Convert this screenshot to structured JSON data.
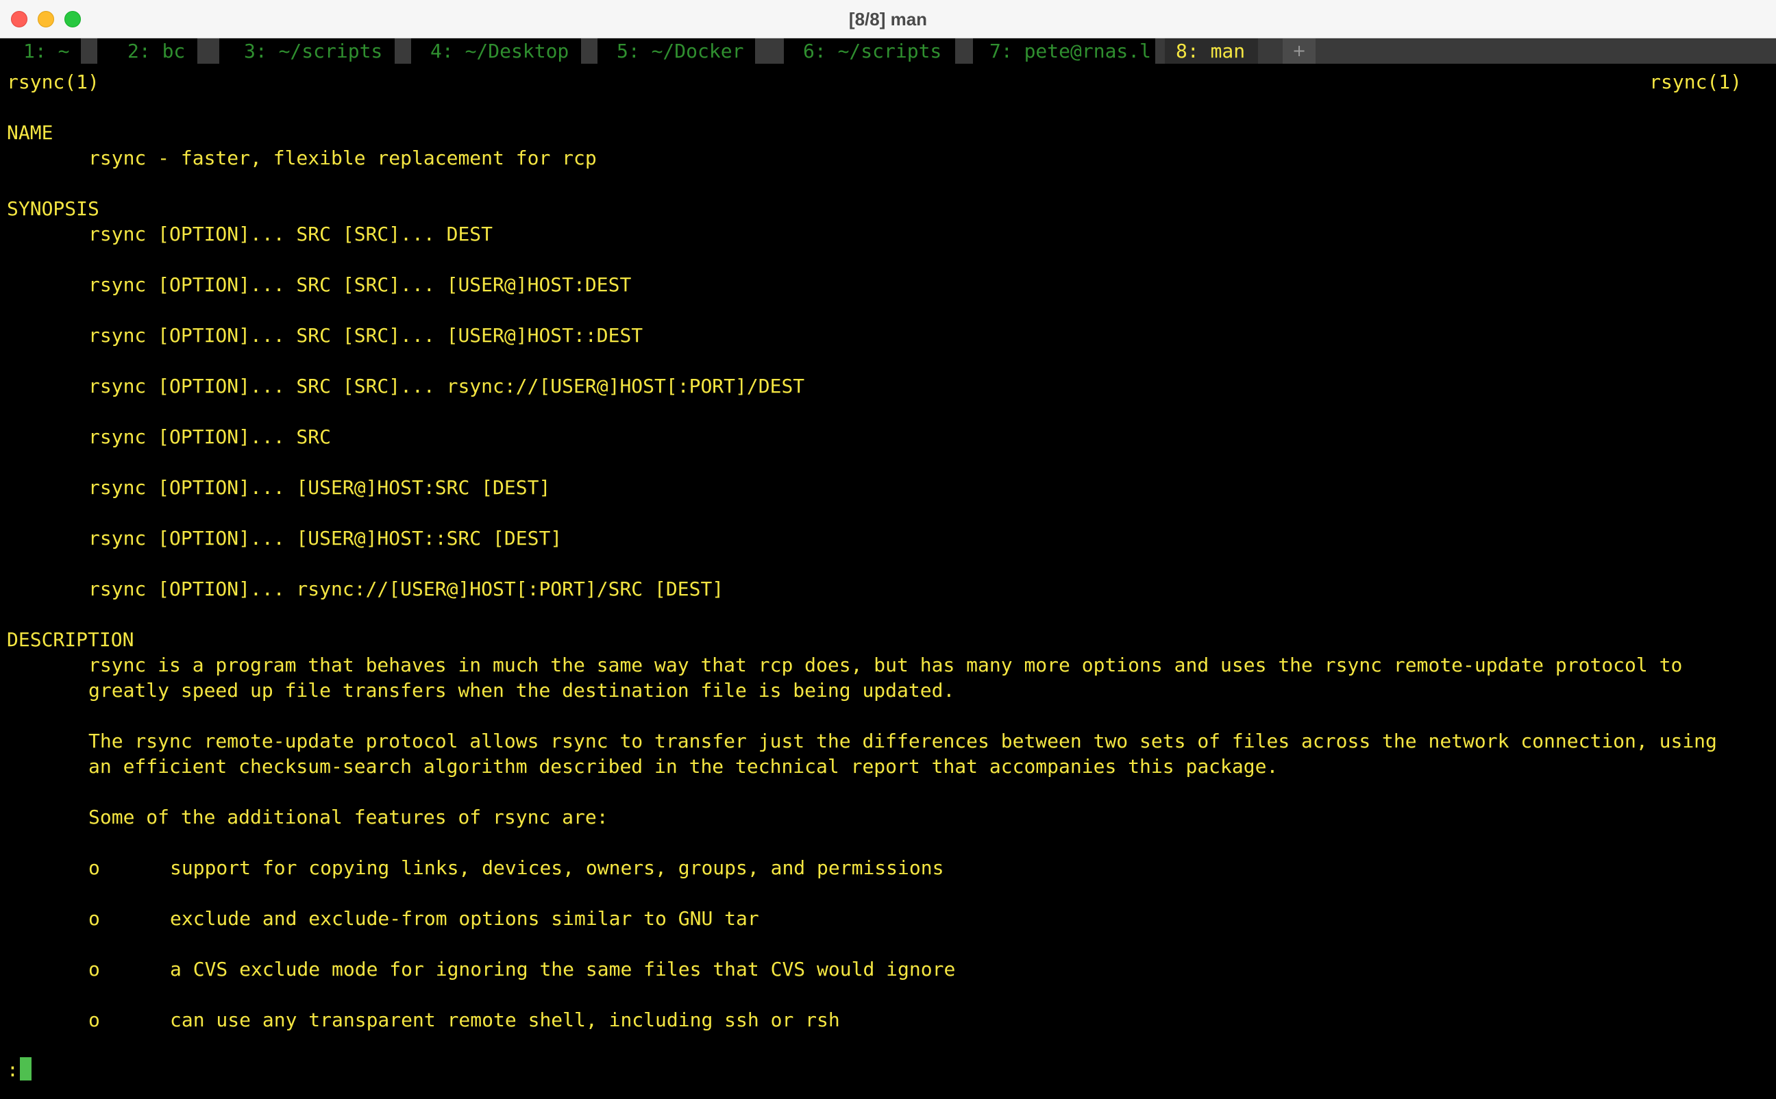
{
  "window": {
    "title": "[8/8] man"
  },
  "colors": {
    "terminal_bg": "#000000",
    "text": "#f5e642",
    "tab_inactive_text": "#2f8f2f",
    "tab_active_text": "#f5e642",
    "cursor": "#4fbf4f"
  },
  "tabs": [
    {
      "label": "1: ~",
      "active": false
    },
    {
      "label": "2: bc",
      "active": false
    },
    {
      "label": "3: ~/scripts",
      "active": false
    },
    {
      "label": "4: ~/Desktop",
      "active": false
    },
    {
      "label": "5: ~/Docker",
      "active": false
    },
    {
      "label": "6: ~/scripts",
      "active": false
    },
    {
      "label": "7: pete@rnas.l",
      "active": false
    },
    {
      "label": "8: man",
      "active": true
    }
  ],
  "tab_add_label": "+",
  "manpage": {
    "header_left": "rsync(1)",
    "header_right": "rsync(1)",
    "name_heading": "NAME",
    "name_text": "rsync - faster, flexible replacement for rcp",
    "synopsis_heading": "SYNOPSIS",
    "synopsis": [
      "rsync [OPTION]... SRC [SRC]... DEST",
      "rsync [OPTION]... SRC [SRC]... [USER@]HOST:DEST",
      "rsync [OPTION]... SRC [SRC]... [USER@]HOST::DEST",
      "rsync [OPTION]... SRC [SRC]... rsync://[USER@]HOST[:PORT]/DEST",
      "rsync [OPTION]... SRC",
      "rsync [OPTION]... [USER@]HOST:SRC [DEST]",
      "rsync [OPTION]... [USER@]HOST::SRC [DEST]",
      "rsync [OPTION]... rsync://[USER@]HOST[:PORT]/SRC [DEST]"
    ],
    "description_heading": "DESCRIPTION",
    "description_p1": [
      "rsync is a program that behaves in much the same way that rcp does, but has many more options and uses the rsync remote-update protocol to",
      "greatly speed up file transfers when the destination file is being updated."
    ],
    "description_p2": [
      "The rsync remote-update protocol allows rsync to transfer just the differences between two sets of files across the network connection, using",
      "an efficient checksum-search algorithm described in the technical report that accompanies this package."
    ],
    "features_intro": "Some of the additional features of rsync are:",
    "bullet": "o",
    "features": [
      "support for copying links, devices, owners, groups, and permissions",
      "exclude and exclude-from options similar to GNU tar",
      "a CVS exclude mode for ignoring the same files that CVS would ignore",
      "can use any transparent remote shell, including ssh or rsh"
    ]
  },
  "pager": {
    "prompt": ":"
  }
}
